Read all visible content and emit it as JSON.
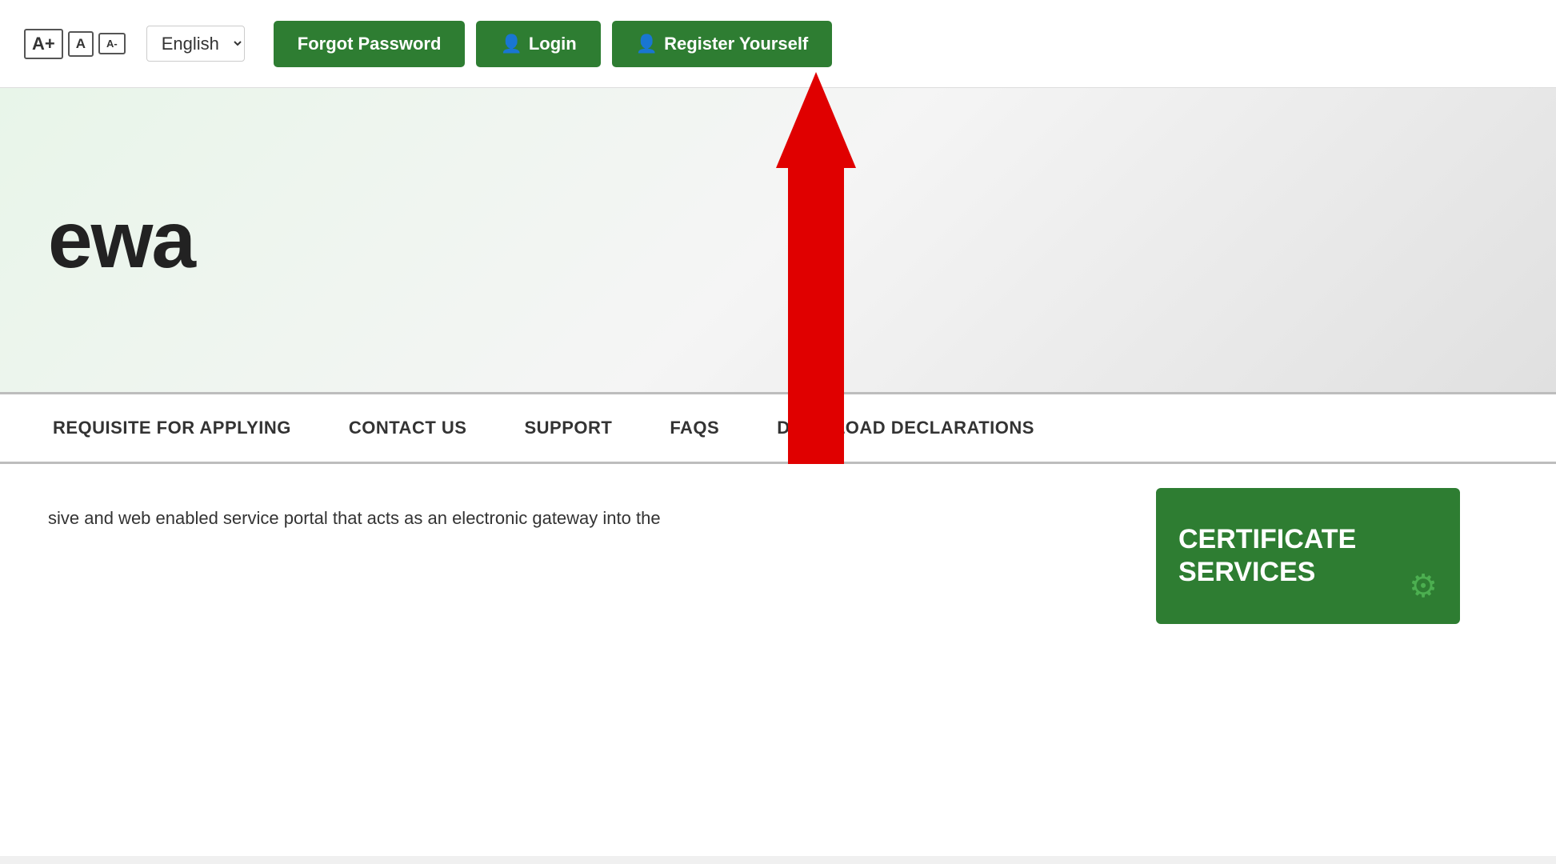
{
  "topbar": {
    "font_large": "A+",
    "font_medium": "A",
    "font_small": "A-",
    "language": "English",
    "forgot_password": "Forgot Password",
    "login": "Login",
    "register": "Register Yourself"
  },
  "hero": {
    "title": "ewa"
  },
  "nav": {
    "items": [
      {
        "label": "REQUISITE FOR APPLYING",
        "id": "requisite"
      },
      {
        "label": "CONTACT US",
        "id": "contact"
      },
      {
        "label": "SUPPORT",
        "id": "support"
      },
      {
        "label": "FAQS",
        "id": "faqs"
      },
      {
        "label": "DOWNLOAD DECLARATIONS",
        "id": "download"
      }
    ]
  },
  "content": {
    "description": "sive and web enabled service portal that acts as an electronic gateway into the"
  },
  "certificate_card": {
    "line1": "CERTIFICATE",
    "line2": "SERVICES"
  },
  "icons": {
    "user_icon": "👤",
    "gear_icon": "⚙"
  }
}
